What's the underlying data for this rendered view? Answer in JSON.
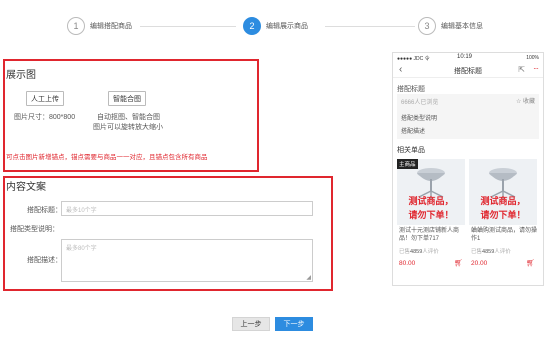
{
  "steps": [
    {
      "num": "1",
      "label": "编辑搭配商品"
    },
    {
      "num": "2",
      "label": "编辑展示商品"
    },
    {
      "num": "3",
      "label": "编辑基本信息"
    }
  ],
  "display": {
    "title": "展示图",
    "manual_upload": "人工上传",
    "smart_compose": "智能合图",
    "size_text": "图片尺寸：800*800",
    "auto_line1": "自动抠图、智能合图",
    "auto_line2": "图片可以旋转放大缩小",
    "note": "可点击图片新增锚点，锚点需要与商品一一对应，且锚点包含所有商品"
  },
  "content": {
    "title": "内容文案",
    "title_label": "搭配标题：",
    "title_placeholder": "最多10个字",
    "type_label": "搭配类型说明：",
    "desc_label": "搭配描述：",
    "desc_placeholder": "最多80个字"
  },
  "buttons": {
    "prev": "上一步",
    "next": "下一步"
  },
  "phone": {
    "carrier": "●●●●● JDC 令",
    "time": "10:19",
    "battery": "100%",
    "nav_title": "搭配标题",
    "title": "搭配标题",
    "views": "6666人已浏览",
    "fav": "☆ 收藏",
    "type": "搭配类型说明",
    "desc": "搭配描述",
    "related": "相关单品",
    "products": [
      {
        "badge": "主商品",
        "test1": "测试商品，",
        "test2": "请勿下单！",
        "name": "测试十元测店铺新人商品！勿下单717",
        "sold_prefix": "已售",
        "sold_num": "4859",
        "sold_suffix": "人评价",
        "price": "80.00"
      },
      {
        "badge": "",
        "test1": "测试商品，",
        "test2": "请勿下单！",
        "name": "蛐蛐购测试商品，请勿操作1",
        "sold_prefix": "已售",
        "sold_num": "4859",
        "sold_suffix": "人评价",
        "price": "20.00"
      }
    ]
  },
  "colors": {
    "accent": "#2d8ce0",
    "highlight": "#e0262e"
  }
}
